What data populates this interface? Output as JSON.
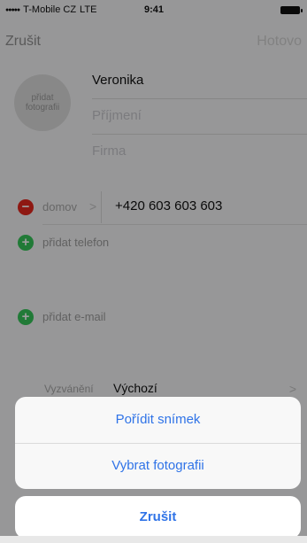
{
  "status_bar": {
    "carrier": "T-Mobile CZ",
    "network": "LTE",
    "time": "9:41"
  },
  "nav": {
    "cancel_label": "Zrušit",
    "done_label": "Hotovo"
  },
  "contact": {
    "photo_label": "přidat fotografii",
    "first_name": "Veronika",
    "last_name_placeholder": "Příjmení",
    "company_placeholder": "Firma"
  },
  "phone": {
    "label": "domov",
    "number": "+420 603 603 603",
    "chevron": ">",
    "add_label": "přidat telefon"
  },
  "email": {
    "add_label": "přidat e-mail"
  },
  "ringtone": {
    "label": "Vyzvánění",
    "value": "Výchozí"
  },
  "action_sheet": {
    "take_photo": "Pořídit snímek",
    "choose_photo": "Vybrat fotografii",
    "cancel": "Zrušit"
  },
  "colors": {
    "accent": "#2f73e7",
    "remove": "#e5271e",
    "add": "#36c65a"
  }
}
